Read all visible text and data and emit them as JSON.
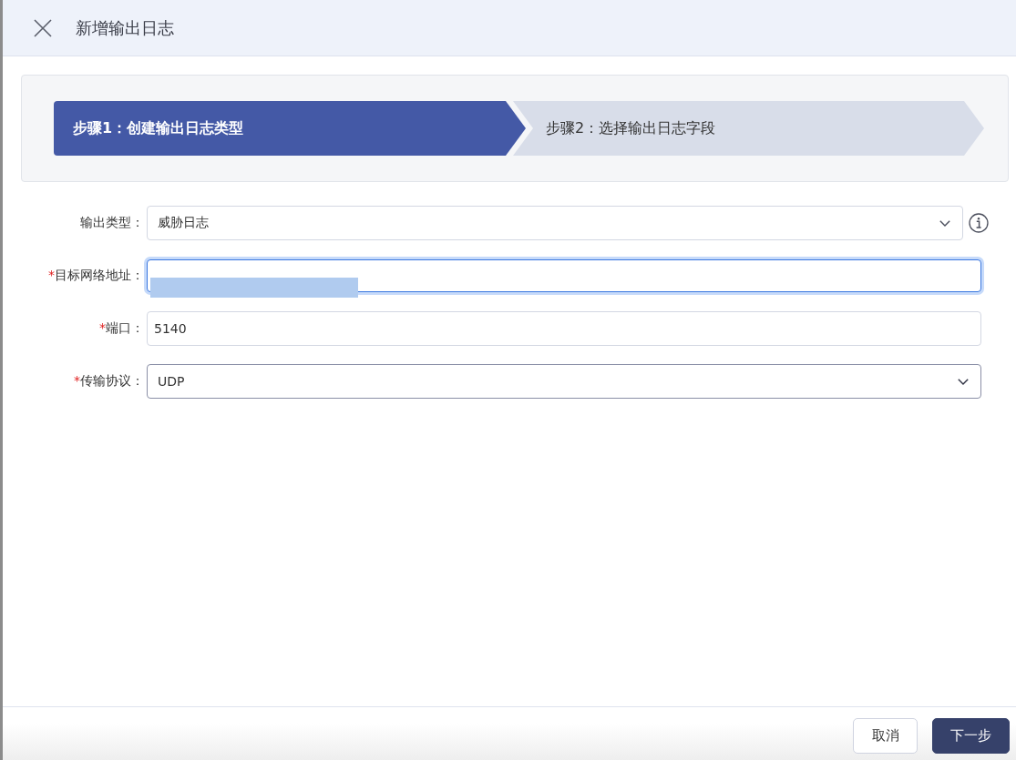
{
  "dialog": {
    "title": "新增输出日志"
  },
  "steps": [
    {
      "label": "步骤1：创建输出日志类型",
      "selected": true
    },
    {
      "label": "步骤2：选择输出日志字段",
      "selected": false
    }
  ],
  "form": {
    "fields": [
      {
        "kind": "select",
        "label": "输出类型：",
        "value": "威胁日志",
        "info": true,
        "focused": false,
        "hovered": false
      },
      {
        "kind": "text",
        "label": "目标网络地址：",
        "required_marker": "*",
        "redacted": true,
        "focused": true,
        "hovered": false
      },
      {
        "kind": "text",
        "label": "端口：",
        "required_marker": "*",
        "value": "5140",
        "focused": false,
        "hovered": false
      },
      {
        "kind": "select",
        "label": "传输协议：",
        "required_marker": "*",
        "value": "UDP",
        "focused": false,
        "hovered": true
      }
    ]
  },
  "buttons": [
    {
      "label": "取消",
      "kind": "secondary"
    },
    {
      "label": "下一步",
      "kind": "primary"
    }
  ]
}
